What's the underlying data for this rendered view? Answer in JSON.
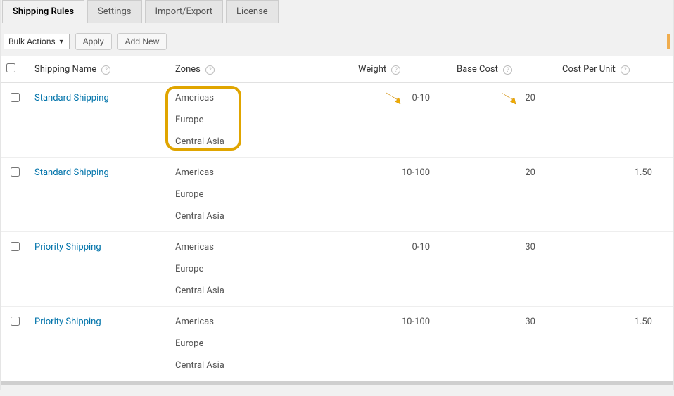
{
  "tabs": [
    {
      "label": "Shipping Rules",
      "active": true
    },
    {
      "label": "Settings",
      "active": false
    },
    {
      "label": "Import/Export",
      "active": false
    },
    {
      "label": "License",
      "active": false
    }
  ],
  "bulk_select": "Bulk Actions",
  "apply_btn": "Apply",
  "add_new_btn": "Add New",
  "columns": {
    "name": "Shipping Name",
    "zones": "Zones",
    "weight": "Weight",
    "base": "Base Cost",
    "unit": "Cost Per Unit"
  },
  "rows": [
    {
      "name": "Standard Shipping",
      "zones": [
        "Americas",
        "Europe",
        "Central Asia"
      ],
      "weight": "0-10",
      "base": "20",
      "unit": "",
      "highlight_zones": true,
      "arrow_weight": true,
      "arrow_base": true
    },
    {
      "name": "Standard Shipping",
      "zones": [
        "Americas",
        "Europe",
        "Central Asia"
      ],
      "weight": "10-100",
      "base": "20",
      "unit": "1.50"
    },
    {
      "name": "Priority Shipping",
      "zones": [
        "Americas",
        "Europe",
        "Central Asia"
      ],
      "weight": "0-10",
      "base": "30",
      "unit": ""
    },
    {
      "name": "Priority Shipping",
      "zones": [
        "Americas",
        "Europe",
        "Central Asia"
      ],
      "weight": "10-100",
      "base": "30",
      "unit": "1.50"
    }
  ]
}
